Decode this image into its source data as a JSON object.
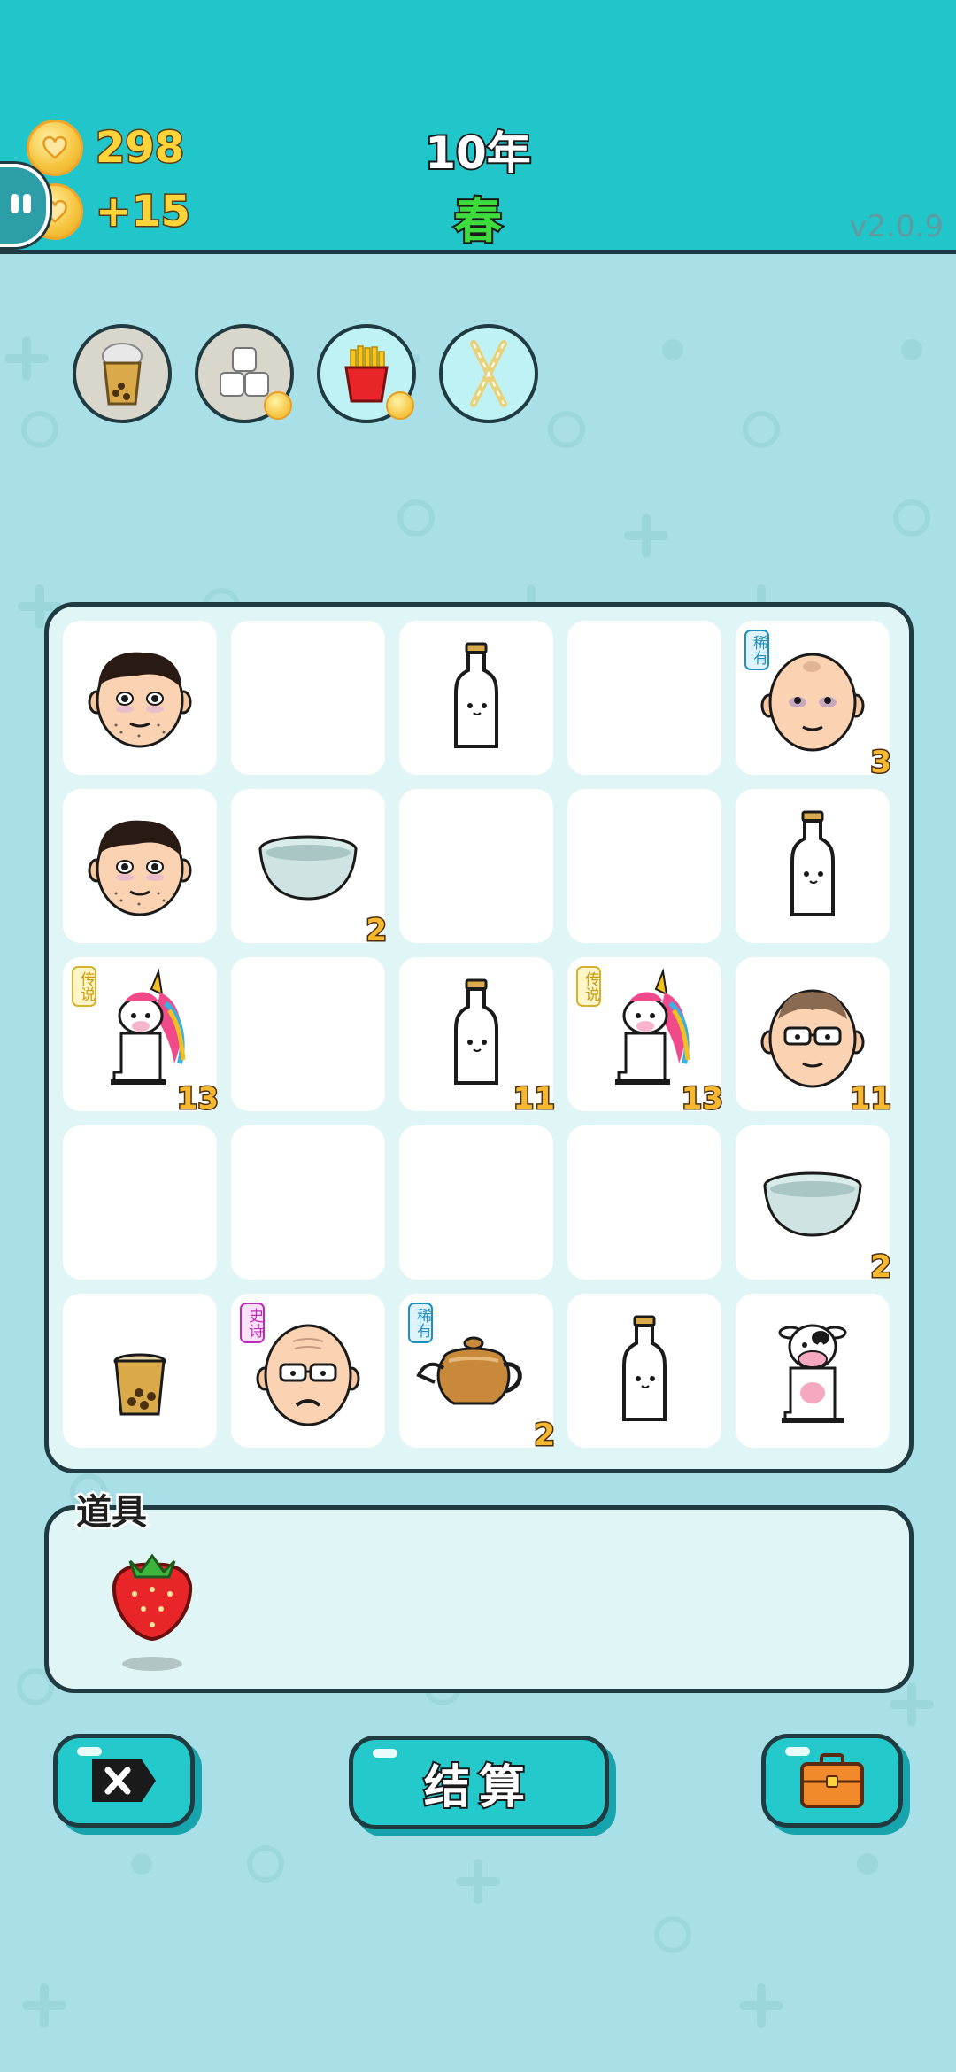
{
  "header": {
    "coins": "298",
    "income": "+15",
    "year": "10年",
    "season": "春",
    "version": "v2.0.9"
  },
  "buffs": [
    {
      "icon": "bubble-tea-icon",
      "bg": "#d9d7cc",
      "has_coin": false
    },
    {
      "icon": "sugar-cubes-icon",
      "bg": "#d9d7cc",
      "has_coin": true
    },
    {
      "icon": "fries-icon",
      "bg": "#bff2f5",
      "has_coin": true
    },
    {
      "icon": "straws-icon",
      "bg": "#bff2f5",
      "has_coin": false
    }
  ],
  "board": {
    "rows": 5,
    "cols": 5,
    "cells": [
      {
        "item": "man-face",
        "count": "",
        "tag": ""
      },
      {
        "item": "",
        "count": "",
        "tag": ""
      },
      {
        "item": "milk-bottle",
        "count": "",
        "tag": ""
      },
      {
        "item": "",
        "count": "",
        "tag": ""
      },
      {
        "item": "bald-man",
        "count": "3",
        "tag": "稀有",
        "tag_type": "rare"
      },
      {
        "item": "man-face",
        "count": "",
        "tag": ""
      },
      {
        "item": "bowl",
        "count": "2",
        "tag": ""
      },
      {
        "item": "",
        "count": "",
        "tag": ""
      },
      {
        "item": "",
        "count": "",
        "tag": ""
      },
      {
        "item": "milk-bottle",
        "count": "",
        "tag": ""
      },
      {
        "item": "unicorn",
        "count": "13",
        "tag": "传说",
        "tag_type": "legend"
      },
      {
        "item": "",
        "count": "",
        "tag": ""
      },
      {
        "item": "milk-bottle",
        "count": "11",
        "tag": ""
      },
      {
        "item": "unicorn",
        "count": "13",
        "tag": "传说",
        "tag_type": "legend"
      },
      {
        "item": "glasses-man",
        "count": "11",
        "tag": ""
      },
      {
        "item": "",
        "count": "",
        "tag": ""
      },
      {
        "item": "",
        "count": "",
        "tag": ""
      },
      {
        "item": "",
        "count": "",
        "tag": ""
      },
      {
        "item": "",
        "count": "",
        "tag": ""
      },
      {
        "item": "bowl",
        "count": "2",
        "tag": ""
      },
      {
        "item": "bubble-tea-cup",
        "count": "",
        "tag": ""
      },
      {
        "item": "old-man",
        "count": "",
        "tag": "史诗",
        "tag_type": "epic"
      },
      {
        "item": "teapot",
        "count": "2",
        "tag": "稀有",
        "tag_type": "rare"
      },
      {
        "item": "milk-bottle",
        "count": "",
        "tag": ""
      },
      {
        "item": "cow",
        "count": "",
        "tag": ""
      }
    ]
  },
  "props": {
    "label": "道具",
    "items": [
      {
        "icon": "strawberry-icon"
      }
    ]
  },
  "buttons": {
    "exit_icon": "close-icon",
    "settle_label": "结算",
    "bag_icon": "briefcase-icon"
  }
}
